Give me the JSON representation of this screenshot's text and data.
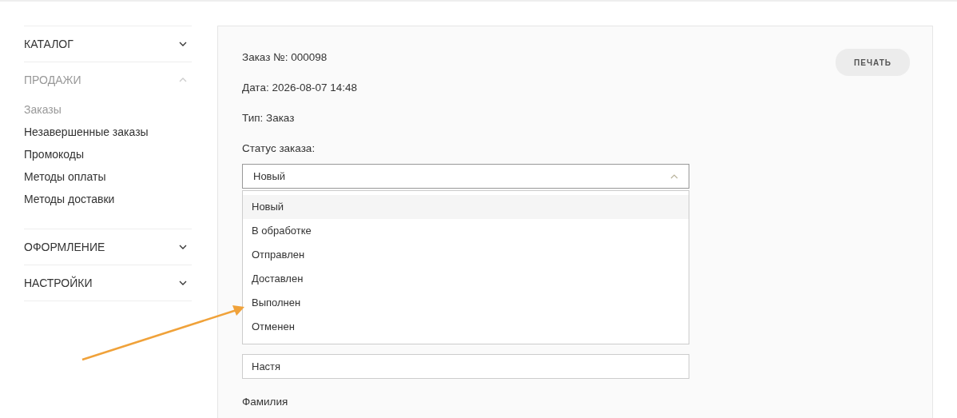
{
  "sidebar": {
    "sections": [
      {
        "label": "КАТАЛОГ",
        "expanded": false
      },
      {
        "label": "ПРОДАЖИ",
        "expanded": true,
        "items": [
          {
            "label": "Заказы",
            "selected": true
          },
          {
            "label": "Незавершенные заказы",
            "selected": false
          },
          {
            "label": "Промокоды",
            "selected": false
          },
          {
            "label": "Методы оплаты",
            "selected": false
          },
          {
            "label": "Методы доставки",
            "selected": false
          }
        ]
      },
      {
        "label": "ОФОРМЛЕНИЕ",
        "expanded": false
      },
      {
        "label": "НАСТРОЙКИ",
        "expanded": false
      }
    ]
  },
  "order": {
    "number": "Заказ №: 000098",
    "date": "Дата: 2026-08-07 14:48",
    "type": "Тип: Заказ",
    "print_button": "ПЕЧАТЬ",
    "status": {
      "label": "Статус заказа:",
      "value": "Новый",
      "expanded": true,
      "options": [
        {
          "label": "Новый",
          "selected": true
        },
        {
          "label": "В обработке",
          "selected": false
        },
        {
          "label": "Отправлен",
          "selected": false
        },
        {
          "label": "Доставлен",
          "selected": false
        },
        {
          "label": "Выполнен",
          "selected": false
        },
        {
          "label": "Отменен",
          "selected": false
        }
      ]
    },
    "name_field": {
      "value": "Настя"
    },
    "surname_label": "Фамилия"
  }
}
